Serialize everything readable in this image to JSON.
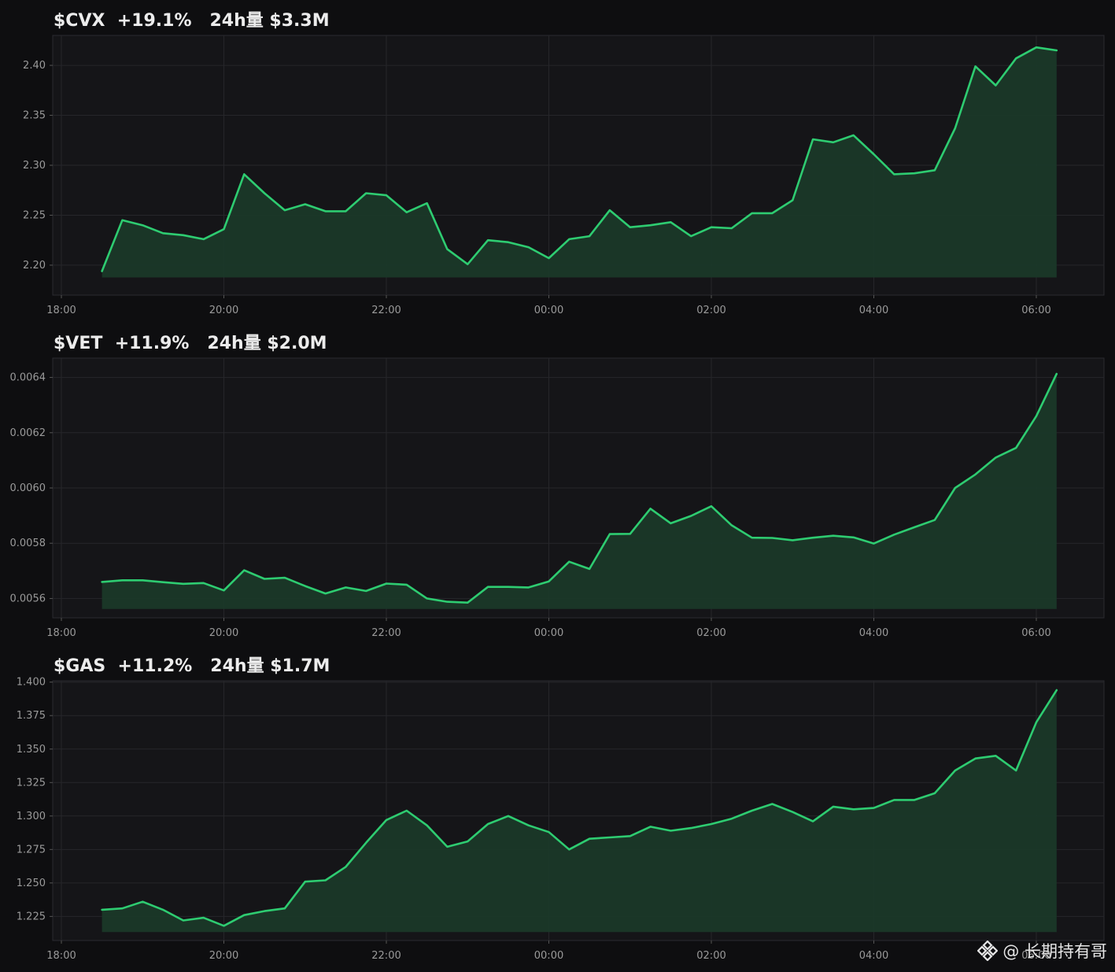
{
  "colors": {
    "background": "#0e0e10",
    "plot_background": "#151518",
    "line": "#2ecc71",
    "fill": "#1b3a29",
    "grid": "#26262a",
    "axis_text": "#9a9a9a",
    "title_text": "#ececec"
  },
  "watermark": {
    "text": "@ 长期持有哥",
    "icon": "binance-logo-icon"
  },
  "chart_data": [
    {
      "type": "area",
      "title": "$CVX  +19.1%   24h量 $3.3M",
      "xlabel": "",
      "ylabel": "",
      "grid": true,
      "x_ticks": [
        "18:00",
        "20:00",
        "22:00",
        "00:00",
        "02:00",
        "04:00",
        "06:00"
      ],
      "y_ticks": [
        "2.20",
        "2.25",
        "2.30",
        "2.35",
        "2.40"
      ],
      "ylim": [
        2.17,
        2.43
      ],
      "x_start_hours": 18.5,
      "x_step_minutes": 15,
      "series": [
        {
          "values": [
            2.194,
            2.245,
            2.24,
            2.232,
            2.23,
            2.226,
            2.236,
            2.291,
            2.272,
            2.255,
            2.261,
            2.254,
            2.254,
            2.272,
            2.27,
            2.253,
            2.262,
            2.216,
            2.201,
            2.225,
            2.223,
            2.218,
            2.207,
            2.226,
            2.229,
            2.255,
            2.238,
            2.24,
            2.243,
            2.229,
            2.238,
            2.237,
            2.252,
            2.252,
            2.265,
            2.326,
            2.323,
            2.33,
            2.311,
            2.291,
            2.292,
            2.295,
            2.337,
            2.399,
            2.38,
            2.407,
            2.418,
            2.415
          ]
        }
      ]
    },
    {
      "type": "area",
      "title": "$VET  +11.9%   24h量 $2.0M",
      "xlabel": "",
      "ylabel": "",
      "grid": true,
      "x_ticks": [
        "18:00",
        "20:00",
        "22:00",
        "00:00",
        "02:00",
        "04:00",
        "06:00"
      ],
      "y_ticks": [
        "0.0056",
        "0.0058",
        "0.0060",
        "0.0062",
        "0.0064"
      ],
      "ylim": [
        0.00553,
        0.00647
      ],
      "x_start_hours": 18.5,
      "x_step_minutes": 15,
      "series": [
        {
          "values": [
            0.00566,
            0.005666,
            0.005666,
            0.005659,
            0.005653,
            0.005656,
            0.005629,
            0.005702,
            0.005671,
            0.005675,
            0.005645,
            0.005618,
            0.00564,
            0.005627,
            0.005654,
            0.00565,
            0.0056,
            0.005588,
            0.005585,
            0.005642,
            0.005642,
            0.00564,
            0.005662,
            0.005733,
            0.005707,
            0.005833,
            0.005834,
            0.005925,
            0.005872,
            0.005899,
            0.005934,
            0.005865,
            0.00582,
            0.005819,
            0.005811,
            0.00582,
            0.005827,
            0.005821,
            0.005799,
            0.005831,
            0.005858,
            0.005884,
            0.006,
            0.006049,
            0.00611,
            0.006145,
            0.00626,
            0.006413
          ]
        }
      ]
    },
    {
      "type": "area",
      "title": "$GAS  +11.2%   24h量 $1.7M",
      "xlabel": "",
      "ylabel": "",
      "grid": true,
      "x_ticks": [
        "18:00",
        "20:00",
        "22:00",
        "00:00",
        "02:00",
        "04:00",
        "06:00"
      ],
      "y_ticks": [
        "1.225",
        "1.250",
        "1.275",
        "1.300",
        "1.325",
        "1.350",
        "1.375",
        "1.400"
      ],
      "ylim": [
        1.207,
        1.401
      ],
      "x_start_hours": 18.5,
      "x_step_minutes": 15,
      "series": [
        {
          "values": [
            1.23,
            1.231,
            1.236,
            1.23,
            1.222,
            1.224,
            1.218,
            1.226,
            1.229,
            1.231,
            1.251,
            1.252,
            1.262,
            1.28,
            1.297,
            1.304,
            1.293,
            1.277,
            1.281,
            1.294,
            1.3,
            1.293,
            1.288,
            1.275,
            1.283,
            1.284,
            1.285,
            1.292,
            1.289,
            1.291,
            1.294,
            1.298,
            1.304,
            1.309,
            1.303,
            1.296,
            1.307,
            1.305,
            1.306,
            1.312,
            1.312,
            1.317,
            1.334,
            1.343,
            1.345,
            1.334,
            1.37,
            1.394
          ]
        }
      ]
    }
  ]
}
